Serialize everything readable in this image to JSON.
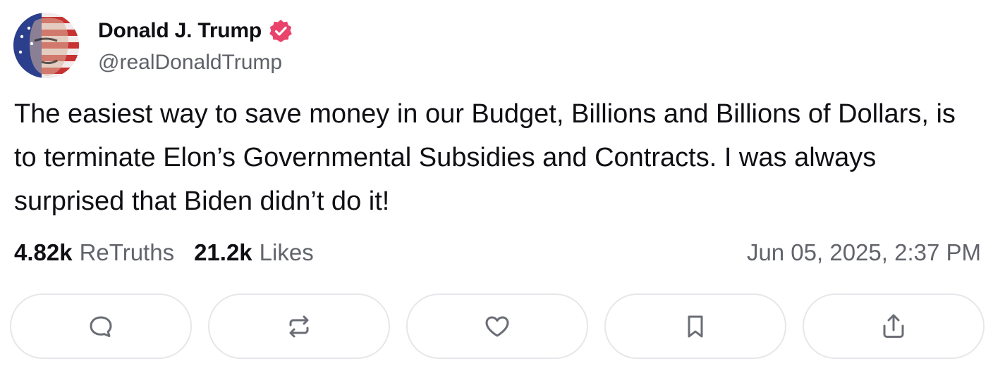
{
  "author": {
    "name": "Donald J. Trump",
    "handle": "@realDonaldTrump",
    "verified_color": "#e9426b"
  },
  "post": {
    "text": "The easiest way to save money in our Budget, Billions and Billions of Dollars, is to terminate Elon’s Governmental Subsidies and Contracts. I was always surprised that Biden didn’t do it!"
  },
  "stats": {
    "retruths_count": "4.82k",
    "retruths_label": "ReTruths",
    "likes_count": "21.2k",
    "likes_label": "Likes"
  },
  "timestamp": "Jun 05, 2025, 2:37 PM",
  "actions": [
    {
      "icon": "reply-icon"
    },
    {
      "icon": "retruth-icon"
    },
    {
      "icon": "like-icon"
    },
    {
      "icon": "bookmark-icon"
    },
    {
      "icon": "share-icon"
    }
  ],
  "colors": {
    "text": "#0f0f14",
    "muted": "#62646b",
    "icon": "#6a6d76",
    "border": "#e6e7ea"
  }
}
